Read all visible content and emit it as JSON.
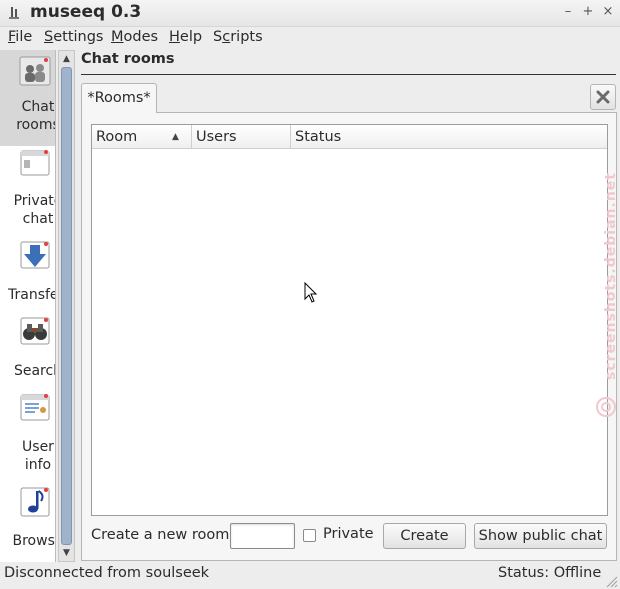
{
  "window": {
    "title": "museeq 0.3",
    "buttons": {
      "minimize": "–",
      "maximize": "+",
      "close": "×"
    }
  },
  "menubar": {
    "items": [
      {
        "label": "File",
        "mnemonic": "F"
      },
      {
        "label": "Settings",
        "mnemonic": "S"
      },
      {
        "label": "Modes",
        "mnemonic": "M"
      },
      {
        "label": "Help",
        "mnemonic": "H"
      },
      {
        "label": "Scripts",
        "mnemonic": "c"
      }
    ]
  },
  "sidebar": {
    "items": [
      {
        "label": "Chat rooms",
        "label_lines": [
          "Chat",
          "rooms"
        ],
        "icon": "chat-rooms-icon",
        "active": true
      },
      {
        "label": "Private chat",
        "label_lines": [
          "Private",
          "chat"
        ],
        "icon": "private-chat-icon",
        "active": false
      },
      {
        "label": "Transfers",
        "label_lines": [
          "Transfers"
        ],
        "icon": "transfers-icon",
        "active": false
      },
      {
        "label": "Search",
        "label_lines": [
          "Search"
        ],
        "icon": "search-binoculars-icon",
        "active": false
      },
      {
        "label": "User info",
        "label_lines": [
          "User",
          "info"
        ],
        "icon": "user-info-icon",
        "active": false
      },
      {
        "label": "Browse",
        "label_lines": [
          "Browse"
        ],
        "icon": "browse-music-icon",
        "active": false
      }
    ],
    "scroll_up": "▲",
    "scroll_down": "▼"
  },
  "main": {
    "section_title": "Chat rooms",
    "tabs": [
      {
        "label": "*Rooms*",
        "active": true
      }
    ],
    "table": {
      "columns": [
        "Room",
        "Users",
        "Status"
      ],
      "sort_column": "Room",
      "sort_indicator": "▲",
      "rows": []
    },
    "create_room_label": "Create a new room:",
    "new_room_input_value": "",
    "private_label": "Private",
    "private_checked": false,
    "create_button": "Create",
    "show_public_chat_button": "Show public chat"
  },
  "statusbar": {
    "message": "Disconnected from soulseek",
    "status": "Status: Offline"
  },
  "watermark": "screenshots.debian.net",
  "colors": {
    "scroll_thumb": "#9fb3cc",
    "sidebar_active": "#d7d7d7",
    "watermark": "#f1c9cd"
  }
}
